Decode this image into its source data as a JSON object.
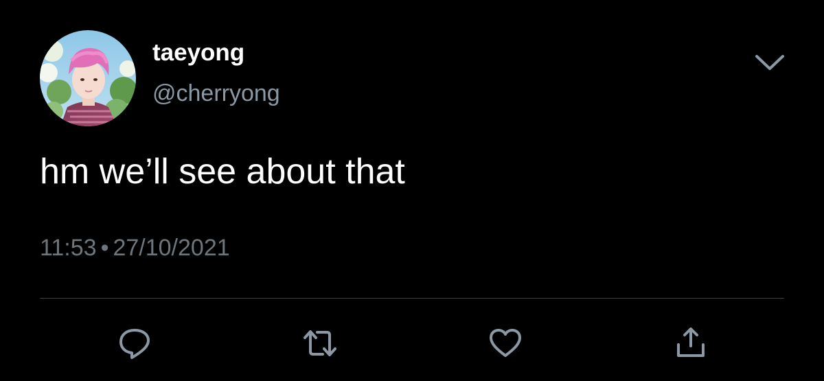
{
  "author": {
    "display_name": "taeyong",
    "handle": "@cherryong"
  },
  "tweet": {
    "text": "hm we’ll see about that",
    "time": "11:53",
    "separator": "•",
    "date": "27/10/2021"
  },
  "icons": {
    "menu": "chevron-down-icon",
    "reply": "reply-icon",
    "retweet": "retweet-icon",
    "like": "heart-icon",
    "share": "share-icon"
  },
  "colors": {
    "background": "#000000",
    "primary_text": "#ffffff",
    "secondary_text": "#8b98a5",
    "icon": "#8b98a5",
    "divider": "#3a3f44"
  }
}
